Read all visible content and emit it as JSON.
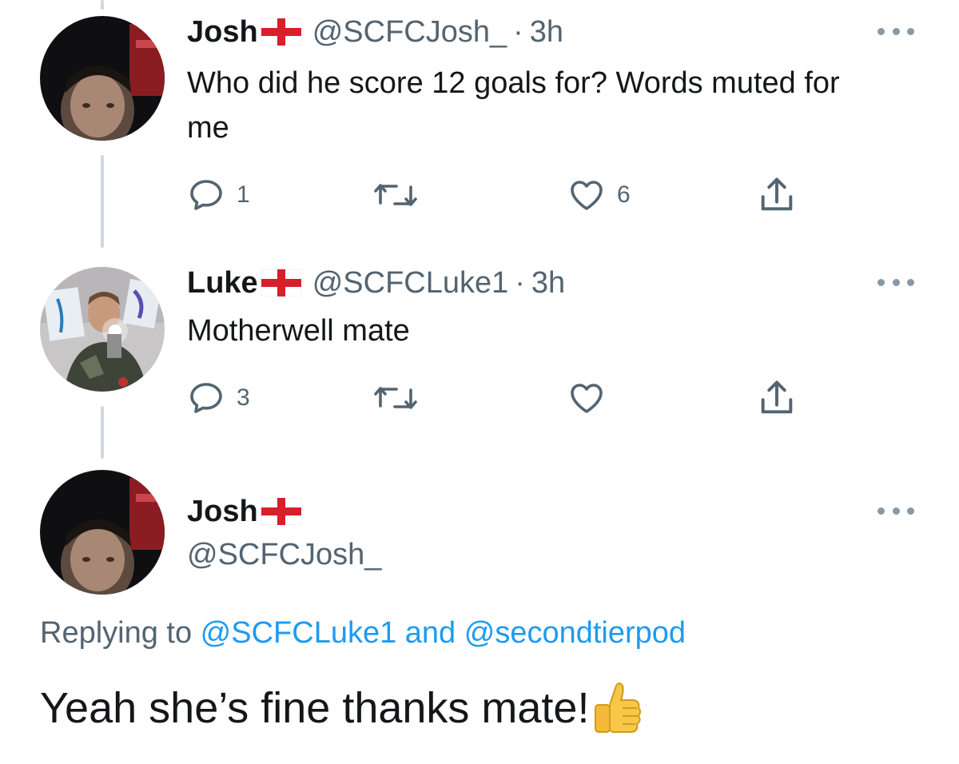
{
  "tweets": [
    {
      "name": "Josh",
      "handle": "@SCFCJosh_",
      "dot": "·",
      "time": "3h",
      "text": "Who did he score 12 goals for? Words muted for me",
      "reply_count": "1",
      "retweet_count": "",
      "like_count": "6"
    },
    {
      "name": "Luke",
      "handle": "@SCFCLuke1",
      "dot": "·",
      "time": "3h",
      "text": "Motherwell mate",
      "reply_count": "3",
      "retweet_count": "",
      "like_count": ""
    }
  ],
  "focused_tweet": {
    "name": "Josh",
    "handle": "@SCFCJosh_",
    "replying_prefix": "Replying to ",
    "replying_user1": "@SCFCLuke1",
    "replying_and": " and ",
    "replying_user2": "@secondtierpod",
    "text": "Yeah she’s fine thanks mate!"
  },
  "icons": {
    "flag": "england-flag-icon",
    "reply": "reply-icon",
    "retweet": "retweet-icon",
    "like": "heart-icon",
    "share": "share-icon",
    "more": "more-icon",
    "emoji": "thumbs-up-emoji"
  },
  "colors": {
    "link": "#1d9bf0",
    "secondary_text": "#536471",
    "thread_line": "#cfd9de"
  }
}
